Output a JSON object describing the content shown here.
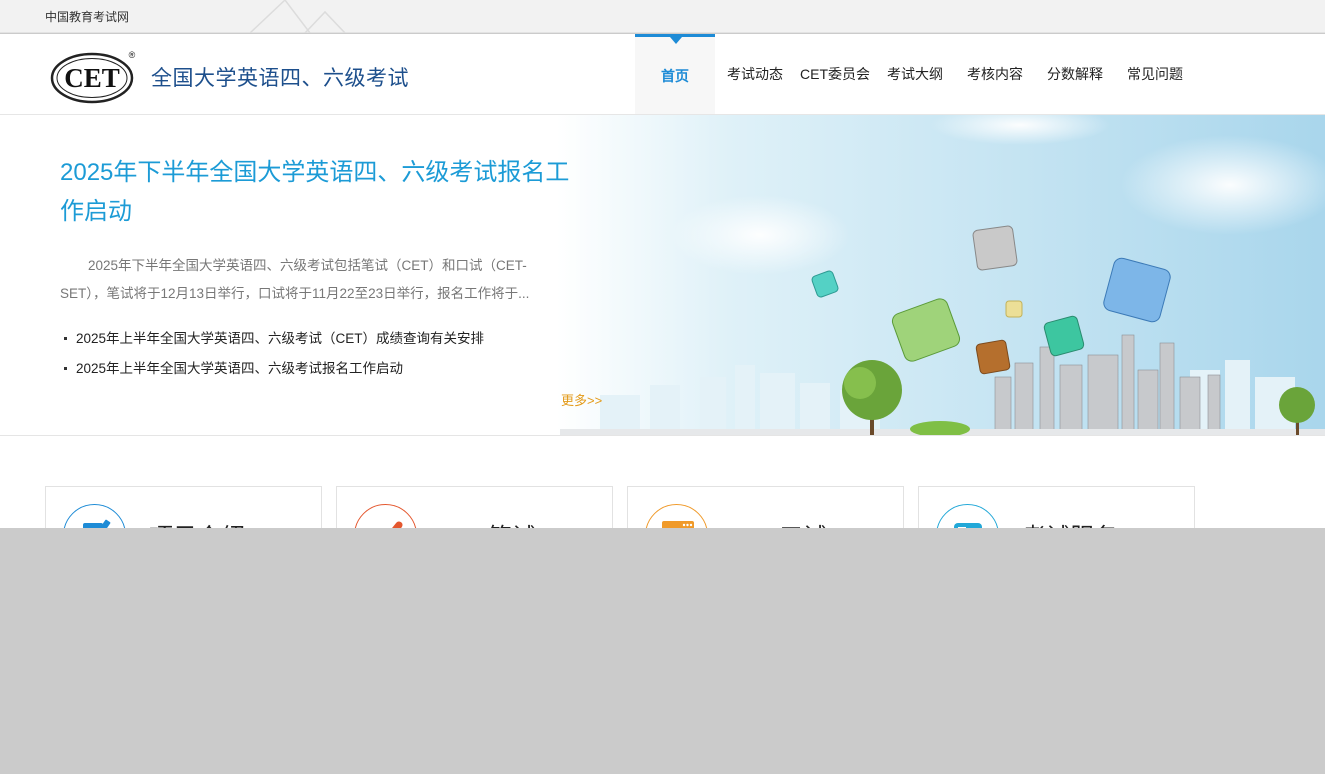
{
  "topbar": {
    "site_link": "中国教育考试网"
  },
  "header": {
    "logo_text": "CET",
    "logo_mark": "®",
    "title": "全国大学英语四、六级考试"
  },
  "nav": {
    "items": [
      {
        "label": "首页"
      },
      {
        "label": "考试动态"
      },
      {
        "label": "CET委员会"
      },
      {
        "label": "考试大纲"
      },
      {
        "label": "考核内容"
      },
      {
        "label": "分数解释"
      },
      {
        "label": "常见问题"
      }
    ]
  },
  "banner": {
    "headline": "2025年下半年全国大学英语四、六级考试报名工作启动",
    "summary": "2025年下半年全国大学英语四、六级考试包括笔试（CET）和口试（CET-SET），笔试将于12月13日举行，口试将于11月22至23日举行，报名工作将于...",
    "news": [
      {
        "title": "2025年上半年全国大学英语四、六级考试（CET）成绩查询有关安排"
      },
      {
        "title": "2025年上半年全国大学英语四、六级考试报名工作启动"
      }
    ],
    "more": "更多>>"
  },
  "cards": [
    {
      "label": "项目介绍",
      "icon": "document-pen-icon",
      "color": "#1d8bd6"
    },
    {
      "label": "CET笔试",
      "icon": "check-icon",
      "color": "#e4572e"
    },
    {
      "label": "CET口试",
      "icon": "speech-icon",
      "color": "#f09a2a"
    },
    {
      "label": "考试服务",
      "icon": "service-icon",
      "color": "#22a8d8"
    }
  ]
}
